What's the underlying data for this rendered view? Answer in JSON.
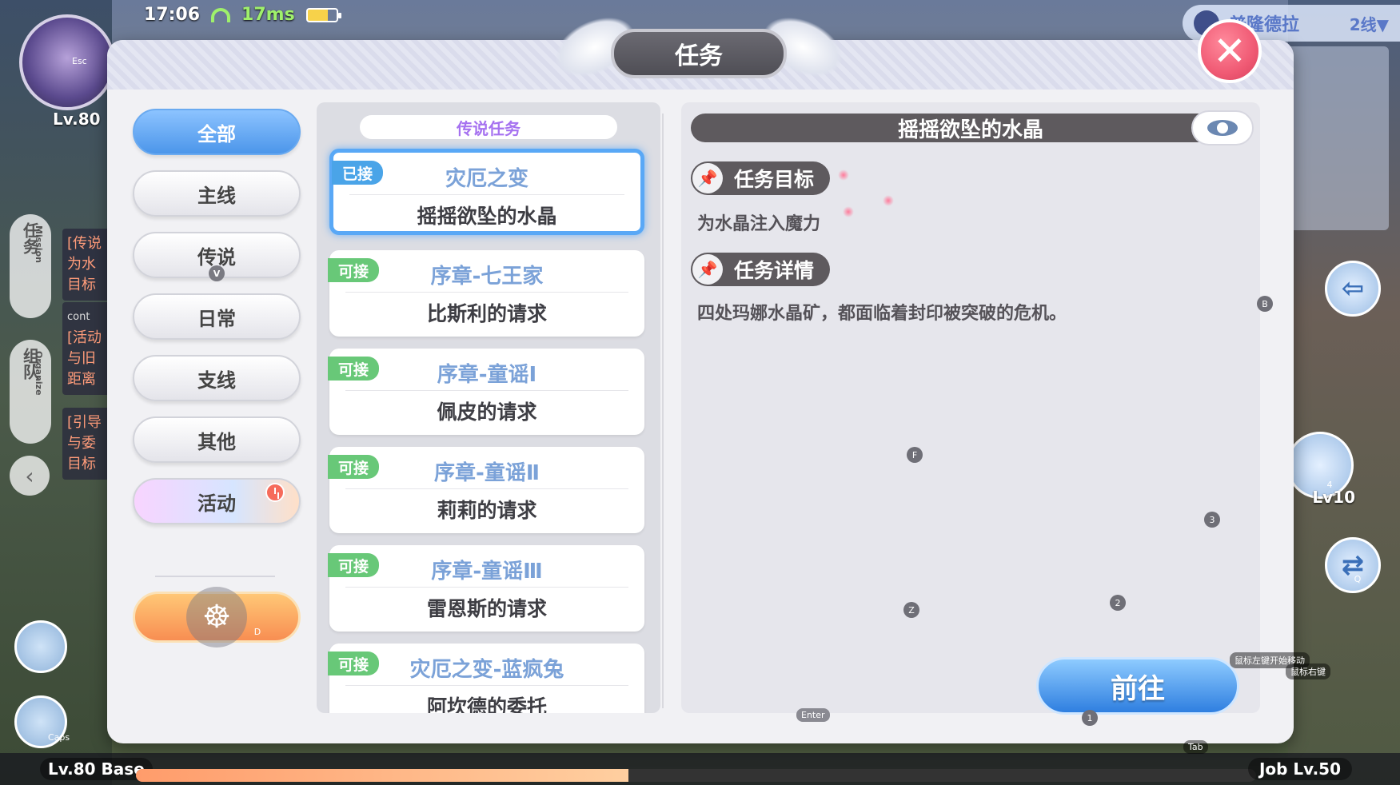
{
  "hud": {
    "time": "17:06",
    "ping": "17ms",
    "level": "Lv.80",
    "esc": "Esc",
    "server": "普隆德拉",
    "line": "2线▼",
    "caps": "Caps",
    "lv10": "Lv10",
    "base_level": "Lv.80 Base",
    "job_level": "Job Lv.50",
    "tab_hint": "Tab"
  },
  "side_tabs": {
    "mission": "任务",
    "mission_en": "Mission",
    "organize": "组队",
    "organize_en": "Organize",
    "peek_lines_1": [
      "[传说",
      "为水",
      "目标"
    ],
    "peek_label": "cont",
    "peek_lines_2": [
      "[活动",
      "与旧",
      "距离"
    ],
    "peek_lines_3": [
      "[引导",
      "与委",
      "目标"
    ]
  },
  "panel": {
    "title": "任务",
    "close": "✕"
  },
  "categories": [
    {
      "label": "全部",
      "active": true
    },
    {
      "label": "主线"
    },
    {
      "label": "传说",
      "key": "V"
    },
    {
      "label": "日常"
    },
    {
      "label": "支线"
    },
    {
      "label": "其他"
    },
    {
      "label": "活动",
      "event": true
    }
  ],
  "quest_list": {
    "header": "传说任务",
    "items": [
      {
        "tag": "已接",
        "chapter": "灾厄之变",
        "name": "摇摇欲坠的水晶",
        "selected": true
      },
      {
        "tag": "可接",
        "chapter": "序章-七王家",
        "name": "比斯利的请求"
      },
      {
        "tag": "可接",
        "chapter": "序章-童谣Ⅰ",
        "name": "佩皮的请求"
      },
      {
        "tag": "可接",
        "chapter": "序章-童谣Ⅱ",
        "name": "莉莉的请求"
      },
      {
        "tag": "可接",
        "chapter": "序章-童谣Ⅲ",
        "name": "雷恩斯的请求"
      },
      {
        "tag": "可接",
        "chapter": "灾厄之变-蓝疯兔",
        "name": "阿坎德的委托"
      }
    ]
  },
  "detail": {
    "title": "摇摇欲坠的水晶",
    "objective_label": "任务目标",
    "objective_text": "为水晶注入魔力",
    "details_label": "任务详情",
    "details_text": "四处玛娜水晶矿，都面临着封印被突破的危机。",
    "go_button": "前往"
  },
  "key_hints": {
    "b": "B",
    "f": "F",
    "three": "3",
    "z": "Z",
    "two": "2",
    "enter": "Enter",
    "one": "1",
    "four": "4",
    "q": "Q",
    "d": "D",
    "left_click": "鼠标左键开始移动",
    "right_click": "鼠标右键"
  },
  "colors": {
    "accent_blue": "#4c96ea",
    "tag_accepted": "#4aa4e8",
    "tag_available": "#68c878",
    "close_red": "#f05a74"
  },
  "icons": [
    "wifi-icon",
    "battery-icon",
    "close-icon",
    "eye-icon",
    "pin-icon",
    "clock-icon",
    "game-controller-icon",
    "back-arrow-icon",
    "swap-icon"
  ]
}
